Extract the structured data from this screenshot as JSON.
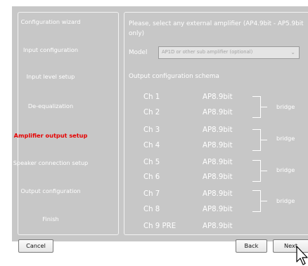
{
  "nav": {
    "items": [
      {
        "label": "Configuration wizard",
        "active": false
      },
      {
        "label": "Input configuration",
        "active": false
      },
      {
        "label": "Input level setup",
        "active": false
      },
      {
        "label": "De-equalization",
        "active": false
      },
      {
        "label": "Amplifier output setup",
        "active": true
      },
      {
        "label": "Speaker connection setup",
        "active": false
      },
      {
        "label": "Output configuration",
        "active": false
      },
      {
        "label": "Finish",
        "active": false
      }
    ]
  },
  "main": {
    "prompt": "Please, select any external amplifier (AP4.9bit - AP5.9bit only)",
    "model_label": "Model",
    "model_placeholder": "AP1D or other sub amplifier (optional)",
    "schema_title": "Output configuration schema",
    "channels": [
      {
        "name": "Ch 1",
        "amp": "AP8.9bit"
      },
      {
        "name": "Ch 2",
        "amp": "AP8.9bit"
      },
      {
        "name": "Ch 3",
        "amp": "AP8.9bit"
      },
      {
        "name": "Ch 4",
        "amp": "AP8.9bit"
      },
      {
        "name": "Ch 5",
        "amp": "AP8.9bit"
      },
      {
        "name": "Ch 6",
        "amp": "AP8.9bit"
      },
      {
        "name": "Ch 7",
        "amp": "AP8.9bit"
      },
      {
        "name": "Ch 8",
        "amp": "AP8.9bit"
      },
      {
        "name": "Ch 9  PRE",
        "amp": "AP8.9bit"
      }
    ],
    "bridges": [
      "bridge",
      "bridge",
      "bridge",
      "bridge"
    ]
  },
  "buttons": {
    "cancel": "Cancel",
    "back": "Back",
    "next": "Next"
  },
  "icons": {
    "dropdown": "chevron-down-icon",
    "cursor": "mouse-pointer-icon"
  },
  "colors": {
    "background": "#c7c7c7",
    "text": "#ffffff",
    "active": "#e60000"
  }
}
